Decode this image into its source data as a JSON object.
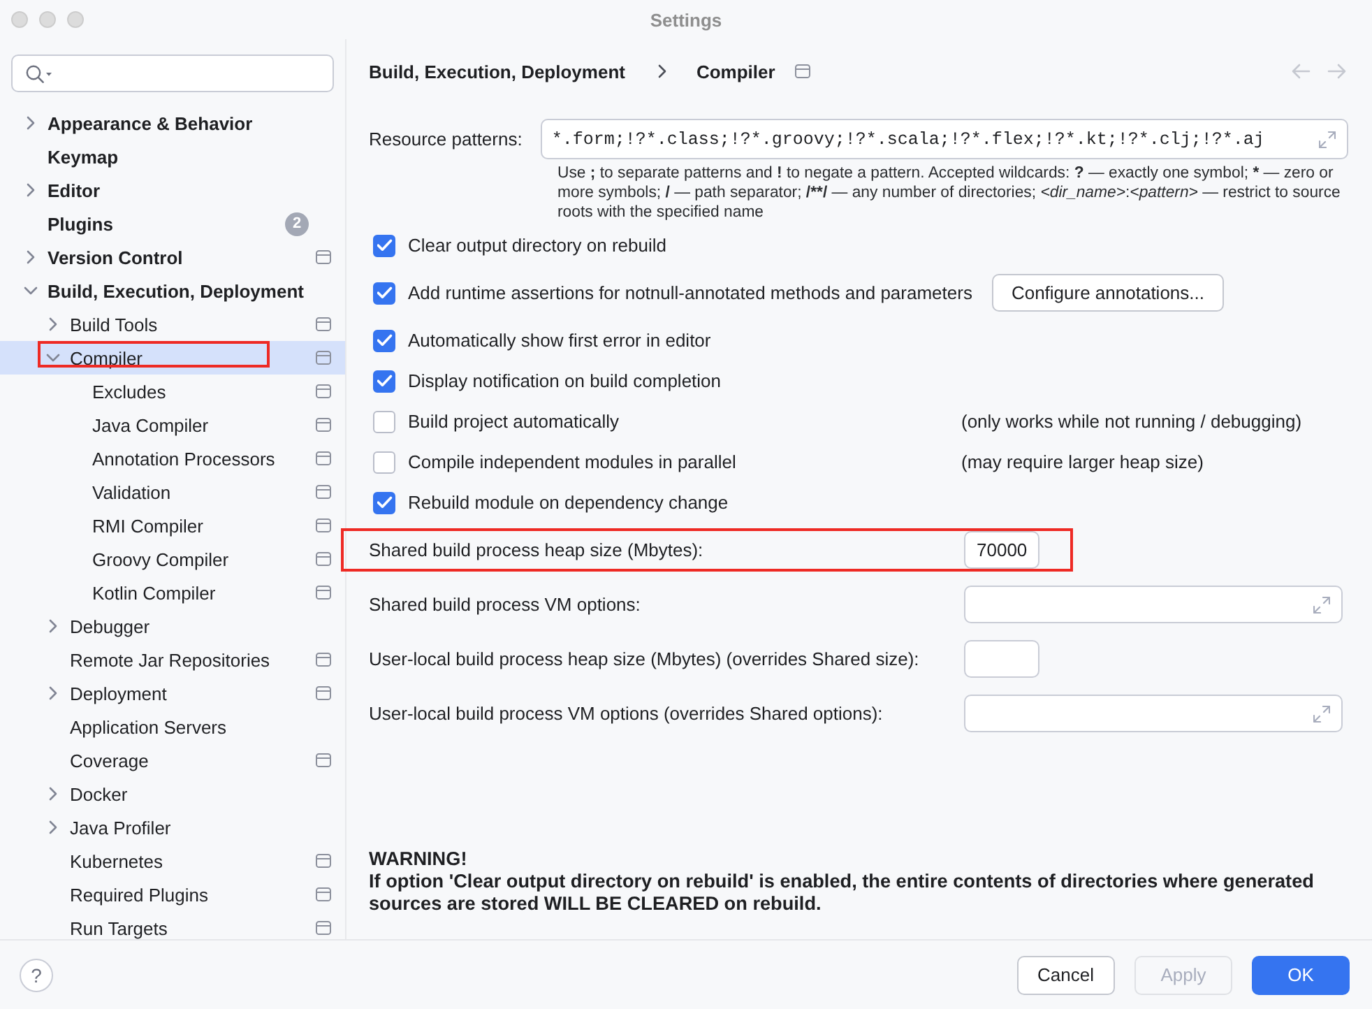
{
  "window": {
    "title": "Settings"
  },
  "sidebar": {
    "items": [
      {
        "label": "Appearance & Behavior",
        "expanded": false,
        "selected": false,
        "highlighted": false,
        "project_scope": false
      },
      {
        "label": "Keymap",
        "selected": false,
        "highlighted": false,
        "project_scope": false
      },
      {
        "label": "Editor",
        "expanded": false,
        "selected": false,
        "highlighted": false,
        "project_scope": false
      },
      {
        "label": "Plugins",
        "badge": "2",
        "selected": false,
        "highlighted": false,
        "project_scope": false
      },
      {
        "label": "Version Control",
        "expanded": false,
        "selected": false,
        "highlighted": false,
        "project_scope": true
      },
      {
        "label": "Build, Execution, Deployment",
        "expanded": true,
        "selected": false,
        "highlighted": false,
        "project_scope": false,
        "children": [
          {
            "label": "Build Tools",
            "expanded": false,
            "selected": false,
            "highlighted": false,
            "project_scope": true
          },
          {
            "label": "Compiler",
            "expanded": true,
            "selected": true,
            "highlighted": true,
            "project_scope": true,
            "children": [
              {
                "label": "Excludes",
                "selected": false,
                "highlighted": false,
                "project_scope": true
              },
              {
                "label": "Java Compiler",
                "selected": false,
                "highlighted": false,
                "project_scope": true
              },
              {
                "label": "Annotation Processors",
                "selected": false,
                "highlighted": false,
                "project_scope": true
              },
              {
                "label": "Validation",
                "selected": false,
                "highlighted": false,
                "project_scope": true
              },
              {
                "label": "RMI Compiler",
                "selected": false,
                "highlighted": false,
                "project_scope": true
              },
              {
                "label": "Groovy Compiler",
                "selected": false,
                "highlighted": false,
                "project_scope": true
              },
              {
                "label": "Kotlin Compiler",
                "selected": false,
                "highlighted": false,
                "project_scope": true
              }
            ]
          },
          {
            "label": "Debugger",
            "expanded": false,
            "selected": false,
            "highlighted": false,
            "project_scope": false
          },
          {
            "label": "Remote Jar Repositories",
            "selected": false,
            "highlighted": false,
            "project_scope": true
          },
          {
            "label": "Deployment",
            "expanded": false,
            "selected": false,
            "highlighted": false,
            "project_scope": true
          },
          {
            "label": "Application Servers",
            "selected": false,
            "highlighted": false,
            "project_scope": false
          },
          {
            "label": "Coverage",
            "selected": false,
            "highlighted": false,
            "project_scope": true
          },
          {
            "label": "Docker",
            "expanded": false,
            "selected": false,
            "highlighted": false,
            "project_scope": false
          },
          {
            "label": "Java Profiler",
            "expanded": false,
            "selected": false,
            "highlighted": false,
            "project_scope": false
          },
          {
            "label": "Kubernetes",
            "selected": false,
            "highlighted": false,
            "project_scope": true
          },
          {
            "label": "Required Plugins",
            "selected": false,
            "highlighted": false,
            "project_scope": true
          },
          {
            "label": "Run Targets",
            "selected": false,
            "highlighted": false,
            "project_scope": true
          }
        ]
      }
    ]
  },
  "breadcrumb": {
    "items": [
      "Build, Execution, Deployment",
      "Compiler"
    ],
    "project_scope": true
  },
  "nav": [
    {
      "kind": "back",
      "disabled": true
    },
    {
      "kind": "forward",
      "disabled": true
    }
  ],
  "resource_patterns": {
    "label": "Resource patterns:",
    "value": "*.form;!?*.class;!?*.groovy;!?*.scala;!?*.flex;!?*.kt;!?*.clj;!?*.aj",
    "hint": [
      {
        "text": "Use ",
        "kind": "text"
      },
      {
        "text": ";",
        "kind": "symbol"
      },
      {
        "text": " to separate patterns and ",
        "kind": "text"
      },
      {
        "text": "!",
        "kind": "symbol"
      },
      {
        "text": " to negate a pattern. Accepted wildcards: ",
        "kind": "text"
      },
      {
        "text": "?",
        "kind": "symbol"
      },
      {
        "text": " — exactly one symbol; ",
        "kind": "text"
      },
      {
        "text": "*",
        "kind": "symbol"
      },
      {
        "text": " — zero or more symbols; ",
        "kind": "text"
      },
      {
        "text": "/",
        "kind": "symbol"
      },
      {
        "text": " — path separator; ",
        "kind": "text"
      },
      {
        "text": "/**/",
        "kind": "symbol"
      },
      {
        "text": " — any number of directories; ",
        "kind": "text"
      },
      {
        "text": "<dir_name>",
        "kind": "placeholder"
      },
      {
        "text": ":",
        "kind": "text"
      },
      {
        "text": "<pattern>",
        "kind": "placeholder"
      },
      {
        "text": " — restrict to source roots with the specified name",
        "kind": "text"
      }
    ]
  },
  "options": [
    {
      "label": "Clear output directory on rebuild",
      "checked": true
    },
    {
      "label": "Add runtime assertions for notnull-annotated methods and parameters",
      "checked": true,
      "button": "Configure annotations..."
    },
    {
      "label": "Automatically show first error in editor",
      "checked": true
    },
    {
      "label": "Display notification on build completion",
      "checked": true
    },
    {
      "label": "Build project automatically",
      "checked": false,
      "note": "(only works while not running / debugging)"
    },
    {
      "label": "Compile independent modules in parallel",
      "checked": false,
      "note": "(may require larger heap size)"
    },
    {
      "label": "Rebuild module on dependency change",
      "checked": true
    }
  ],
  "fields": [
    {
      "label": "Shared build process heap size (Mbytes):",
      "kind": "number",
      "value": "70000",
      "highlighted": true
    },
    {
      "label": "Shared build process VM options:",
      "kind": "expandable",
      "highlighted": false
    },
    {
      "label": "User-local build process heap size (Mbytes) (overrides Shared size):",
      "kind": "number",
      "highlighted": false
    },
    {
      "label": "User-local build process VM options (overrides Shared options):",
      "kind": "expandable",
      "highlighted": false
    }
  ],
  "warning": {
    "title": "WARNING!",
    "text": "If option 'Clear output directory on rebuild' is enabled, the entire contents of directories where generated sources are stored WILL BE CLEARED on rebuild."
  },
  "footer": {
    "help": "?",
    "buttons": [
      {
        "label": "Cancel",
        "kind": "default",
        "disabled": false
      },
      {
        "label": "Apply",
        "kind": "default",
        "disabled": true
      },
      {
        "label": "OK",
        "kind": "primary",
        "disabled": false
      }
    ]
  }
}
